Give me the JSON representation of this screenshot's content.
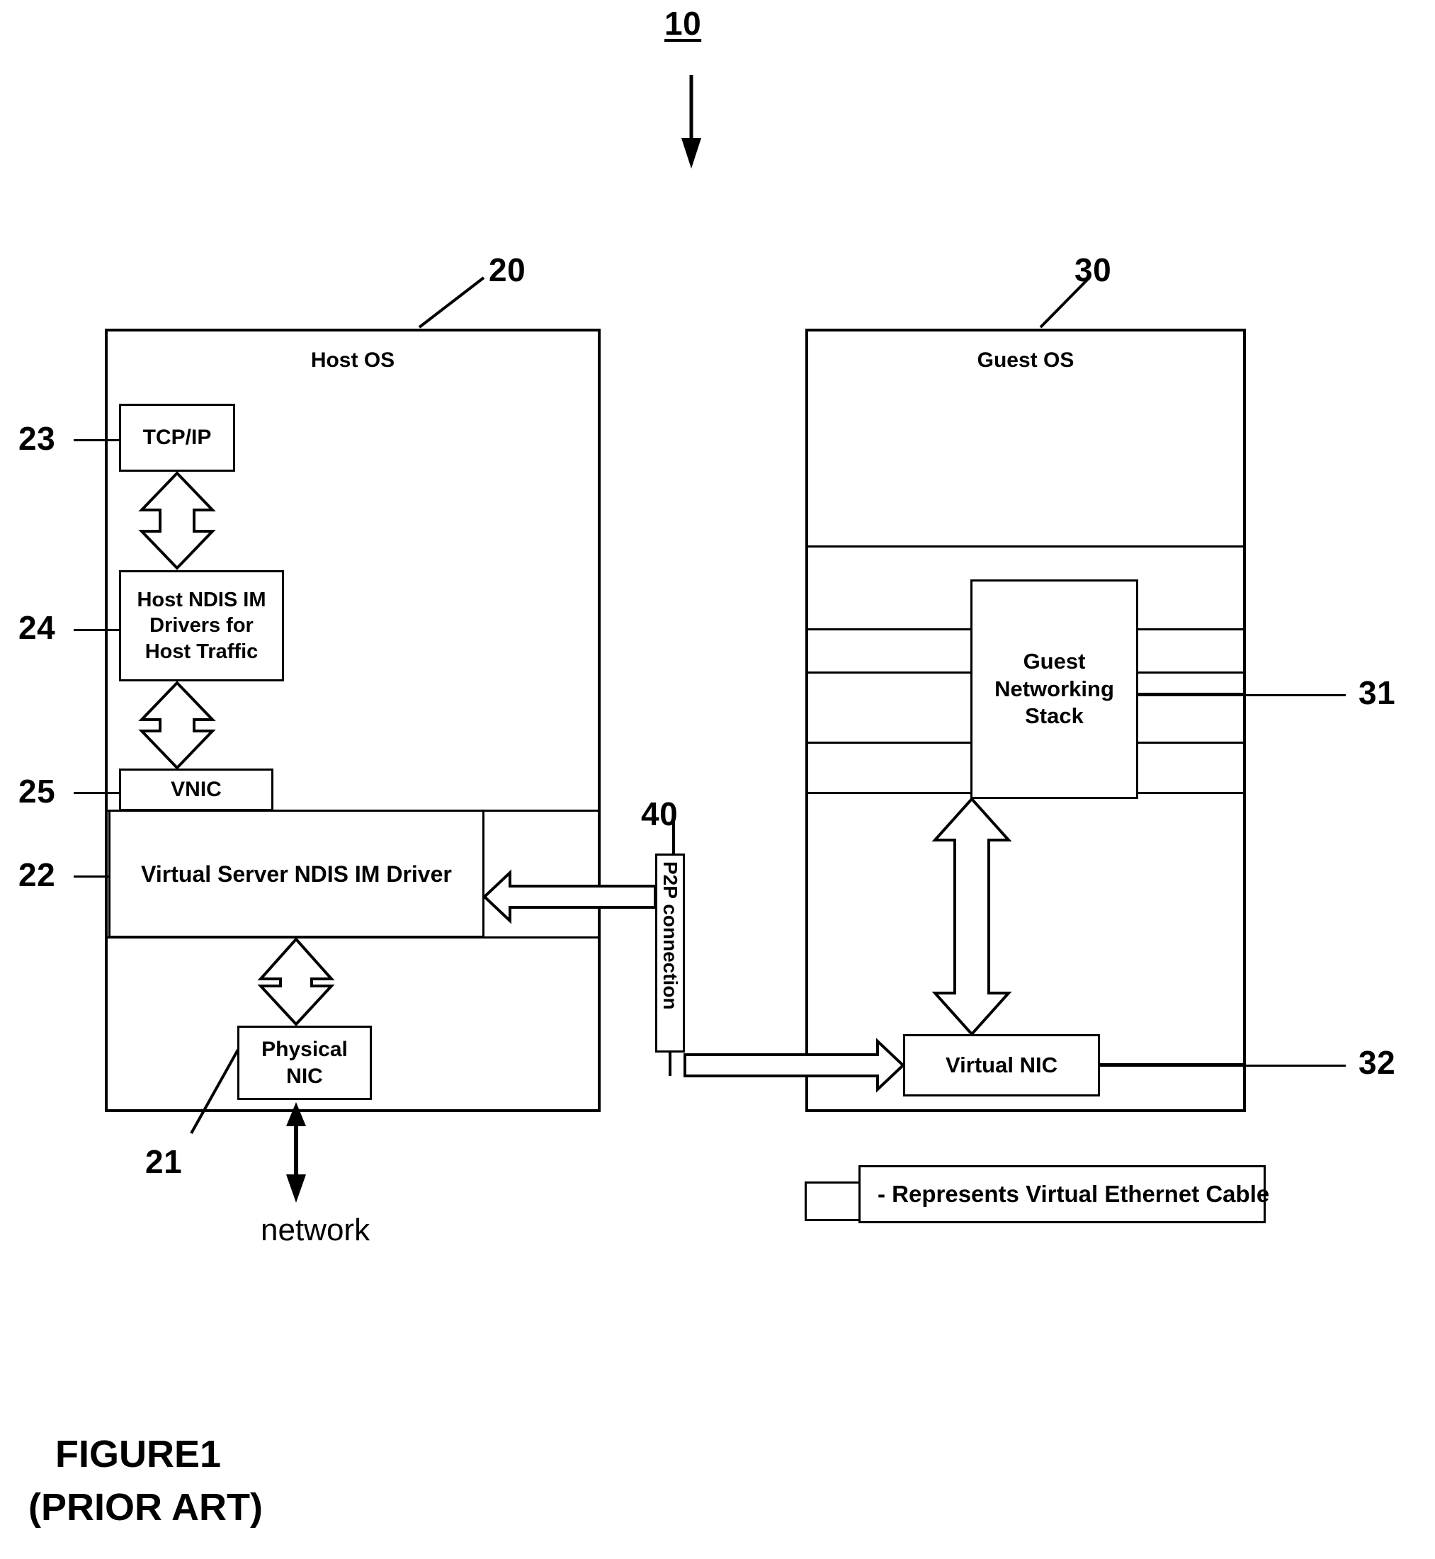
{
  "figure": {
    "top_ref": "10",
    "caption_line1": "FIGURE1",
    "caption_line2": "(PRIOR ART)"
  },
  "host": {
    "ref": "20",
    "title": "Host OS",
    "components": [
      {
        "ref": "23",
        "label": "TCP/IP"
      },
      {
        "ref": "24",
        "label": "Host NDIS IM Drivers for Host Traffic"
      },
      {
        "ref": "25",
        "label": "VNIC"
      },
      {
        "ref": "22",
        "label": "Virtual Server NDIS IM Driver"
      },
      {
        "ref": "21",
        "label": "Physical NIC"
      }
    ],
    "tcpip_label": "TCP/IP",
    "ndis_label_line1": "Host NDIS IM",
    "ndis_label_line2": "Drivers for",
    "ndis_label_line3": "Host Traffic",
    "vnic_label": "VNIC",
    "virtual_server_label": "Virtual Server NDIS IM Driver",
    "physical_nic_line1": "Physical",
    "physical_nic_line2": "NIC",
    "network_label": "network"
  },
  "connection": {
    "ref": "40",
    "label": "P2P connection"
  },
  "guest": {
    "ref": "30",
    "title": "Guest OS",
    "components": [
      {
        "ref": "31",
        "label": "Guest Networking Stack"
      },
      {
        "ref": "32",
        "label": "Virtual NIC"
      }
    ],
    "stack_line1": "Guest",
    "stack_line2": "Networking",
    "stack_line3": "Stack",
    "virtual_nic_label": "Virtual NIC"
  },
  "legend": {
    "text": "- Represents Virtual Ethernet Cable"
  },
  "colors": {
    "stroke": "#000000",
    "background": "#ffffff"
  }
}
